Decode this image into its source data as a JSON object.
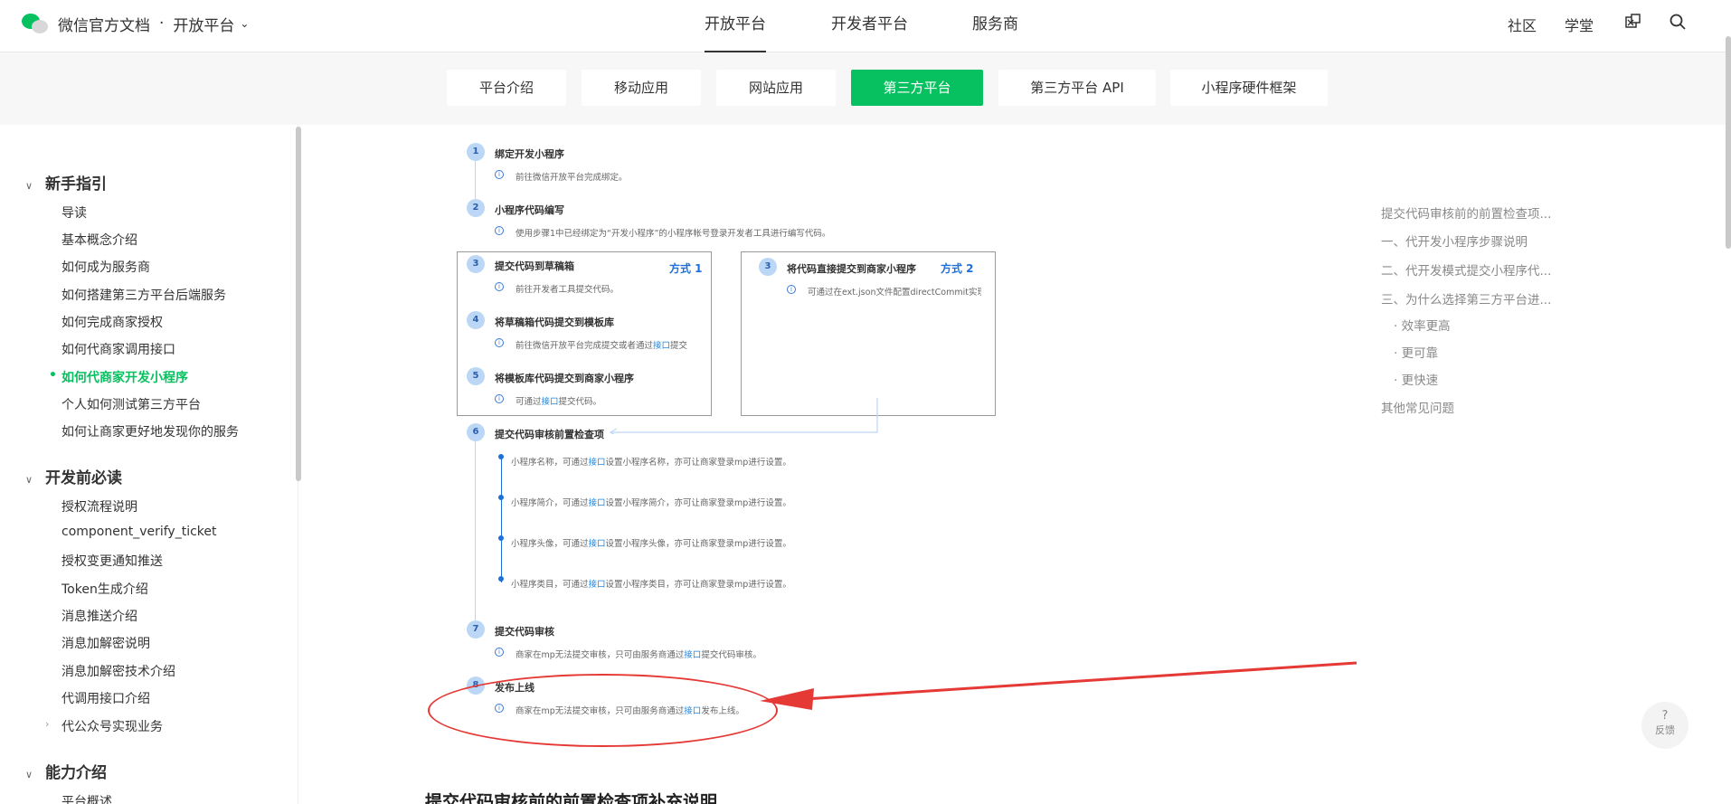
{
  "brand": {
    "title": "微信官方文档",
    "separator": "·",
    "platform": "开放平台",
    "chevron": "⌄"
  },
  "topnav": {
    "tabs": [
      "开放平台",
      "开发者平台",
      "服务商"
    ],
    "active": "开放平台",
    "right": [
      "社区",
      "学堂"
    ]
  },
  "subtabs": {
    "items": [
      "平台介绍",
      "移动应用",
      "网站应用",
      "第三方平台",
      "第三方平台 API",
      "小程序硬件框架"
    ],
    "active": "第三方平台"
  },
  "sidebar": {
    "sections": [
      {
        "title": "新手指引",
        "items": [
          "导读",
          "基本概念介绍",
          "如何成为服务商",
          "如何搭建第三方平台后端服务",
          "如何完成商家授权",
          "如何代商家调用接口",
          "如何代商家开发小程序",
          "个人如何测试第三方平台",
          "如何让商家更好地发现你的服务"
        ],
        "active_item": "如何代商家开发小程序"
      },
      {
        "title": "开发前必读",
        "items": [
          "授权流程说明",
          "component_verify_ticket",
          "授权变更通知推送",
          "Token生成介绍",
          "消息推送介绍",
          "消息加解密说明",
          "消息加解密技术介绍",
          "代调用接口介绍",
          "代公众号实现业务"
        ]
      },
      {
        "title": "能力介绍",
        "items": [
          "平台概述"
        ]
      }
    ]
  },
  "diagram": {
    "link_text": "接口",
    "steps": [
      {
        "num": "1",
        "title": "绑定开发小程序",
        "desc": "前往微信开放平台完成绑定。"
      },
      {
        "num": "2",
        "title": "小程序代码编写",
        "desc": "使用步骤1中已经绑定为“开发小程序”的小程序帐号登录开发者工具进行编写代码。"
      },
      {
        "num": "3",
        "title": "提交代码到草稿箱",
        "desc": "前往开发者工具提交代码。"
      },
      {
        "num": "4",
        "title": "将草稿箱代码提交到模板库",
        "desc_pre": "前往微信开放平台完成提交或者通过",
        "desc_post": "提交"
      },
      {
        "num": "5",
        "title": "将模板库代码提交到商家小程序",
        "desc_pre": "可通过",
        "desc_post": "提交代码。"
      },
      {
        "num": "3",
        "title": "将代码直接提交到商家小程序",
        "desc": "可通过在ext.json文件配置directCommit实现"
      },
      {
        "num": "6",
        "title": "提交代码审核前置检查项"
      },
      {
        "num": "7",
        "title": "提交代码审核",
        "desc_pre": "商家在mp无法提交审核，只可由服务商通过",
        "desc_post": "提交代码审核。"
      },
      {
        "num": "8",
        "title": "发布上线",
        "desc_pre": "商家在mp无法提交审核，只可由服务商通过",
        "desc_post": "发布上线。"
      }
    ],
    "method1": "方式 1",
    "method2": "方式 2",
    "checks": [
      {
        "pre": "小程序名称，可通过",
        "post": "设置小程序名称，亦可让商家登录mp进行设置。"
      },
      {
        "pre": "小程序简介，可通过",
        "post": "设置小程序简介，亦可让商家登录mp进行设置。"
      },
      {
        "pre": "小程序头像，可通过",
        "post": "设置小程序头像，亦可让商家登录mp进行设置。"
      },
      {
        "pre": "小程序类目，可通过",
        "post": "设置小程序类目，亦可让商家登录mp进行设置。"
      }
    ],
    "annotation_color": "#e53935"
  },
  "toc": [
    "提交代码审核前的前置检查项...",
    "一、代开发小程序步骤说明",
    "二、代开发模式提交小程序代...",
    "三、为什么选择第三方平台进...",
    "· 效率更高",
    "· 更可靠",
    "· 更快速",
    "其他常见问题"
  ],
  "bottom_heading": "提交代码审核前的前置检查项补充说明",
  "feedback": {
    "q": "?",
    "label": "反馈"
  },
  "colors": {
    "accent": "#07c160",
    "link": "#1e88e5"
  }
}
